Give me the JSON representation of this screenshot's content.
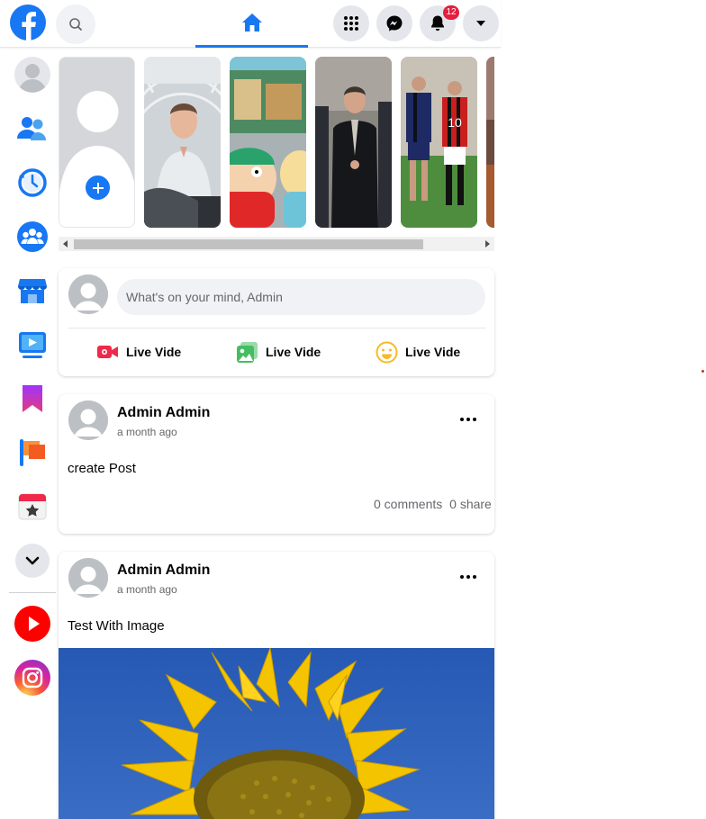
{
  "topbar": {
    "notifications_count": "12"
  },
  "composer": {
    "placeholder": "What's on your mind, Admin",
    "actions": [
      {
        "label": "Live Vide",
        "icon": "live-video-icon"
      },
      {
        "label": "Live Vide",
        "icon": "photo-icon"
      },
      {
        "label": "Live Vide",
        "icon": "feeling-icon"
      }
    ]
  },
  "posts": [
    {
      "author": "Admin Admin",
      "time": "a month ago",
      "text": "create Post",
      "comments": "0 comments",
      "shares": "0 share"
    },
    {
      "author": "Admin Admin",
      "time": "a month ago",
      "text": "Test With Image"
    }
  ],
  "sidebar": {
    "items": [
      "profile-icon",
      "friends-icon",
      "memories-icon",
      "groups-icon",
      "marketplace-icon",
      "watch-icon",
      "saved-icon",
      "pages-icon",
      "events-icon",
      "see-more-icon",
      "youtube-icon",
      "instagram-icon"
    ]
  },
  "colors": {
    "brand": "#1877f2",
    "badge": "#e41e3f",
    "bg_light": "#f0f2f5"
  }
}
